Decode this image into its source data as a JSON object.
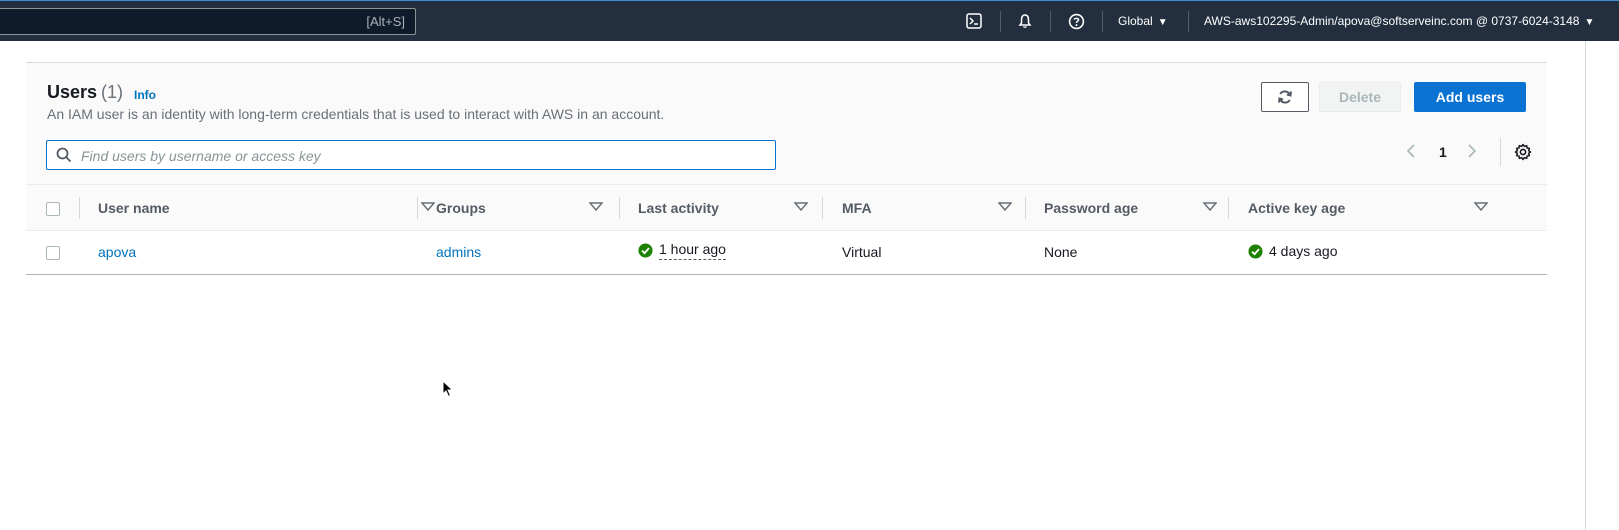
{
  "topnav": {
    "search_shortcut": "[Alt+S]",
    "region_label": "Global",
    "account_label": "AWS-aws102295-Admin/apova@softserveinc.com @ 0737-6024-3148",
    "icons": [
      "cloudshell-icon",
      "bell-icon",
      "help-icon"
    ]
  },
  "users_panel": {
    "title": "Users",
    "count": "(1)",
    "info_link": "Info",
    "description": "An IAM user is an identity with long-term credentials that is used to interact with AWS in an account.",
    "buttons": {
      "delete": "Delete",
      "add": "Add users"
    },
    "filter_placeholder": "Find users by username or access key",
    "pagination": {
      "current_page": "1"
    }
  },
  "table": {
    "columns": [
      "User name",
      "Groups",
      "Last activity",
      "MFA",
      "Password age",
      "Active key age"
    ],
    "rows": [
      {
        "user_name": "apova",
        "groups": "admins",
        "last_activity": "1 hour ago",
        "mfa": "Virtual",
        "password_age": "None",
        "active_key_age": "4 days ago"
      }
    ]
  },
  "colors": {
    "nav_bg": "#232f3e",
    "primary": "#0972d3",
    "link": "#0073bb",
    "success": "#1d8102"
  }
}
